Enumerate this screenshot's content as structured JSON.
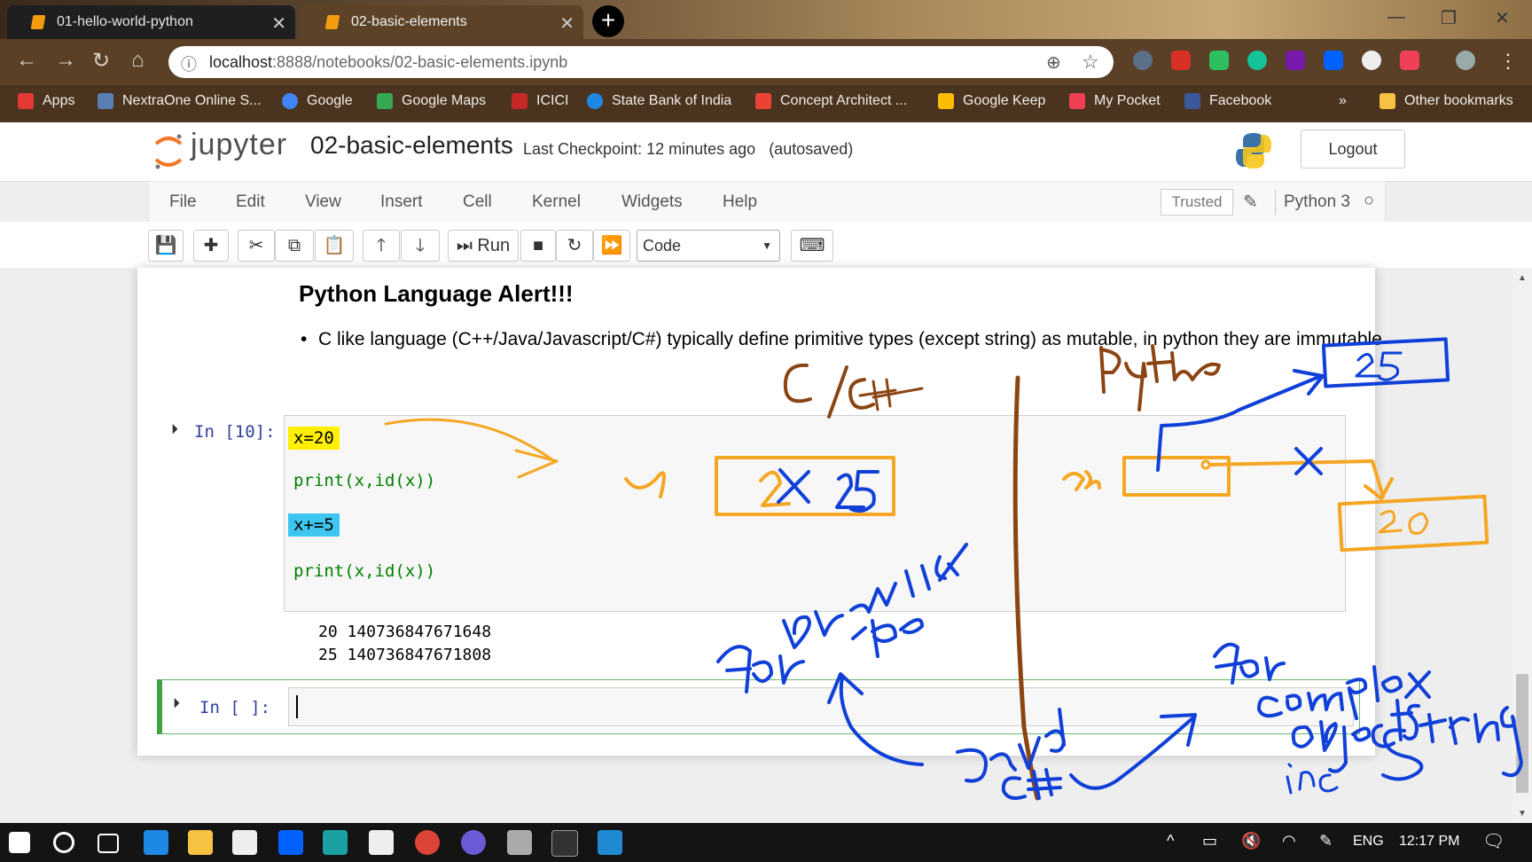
{
  "browser": {
    "tabs": [
      {
        "title": "01-hello-world-python"
      },
      {
        "title": "02-basic-elements"
      }
    ],
    "url_host": "localhost",
    "url_path": ":8888/notebooks/02-basic-elements.ipynb",
    "bookmarks": [
      {
        "label": "Apps",
        "color": "#e53935"
      },
      {
        "label": "NextraOne Online S...",
        "color": "#5b7fb5"
      },
      {
        "label": "Google",
        "color": "#4285f4"
      },
      {
        "label": "Google Maps",
        "color": "#34a853"
      },
      {
        "label": "ICICI",
        "color": "#c62828"
      },
      {
        "label": "State Bank of India",
        "color": "#1e88e5"
      },
      {
        "label": "Concept Architect ...",
        "color": "#ea4335"
      },
      {
        "label": "Google Keep",
        "color": "#fbbc04"
      },
      {
        "label": "My Pocket",
        "color": "#ef4056"
      },
      {
        "label": "Facebook",
        "color": "#3b5998"
      }
    ],
    "more": "»",
    "other_bookmarks": "Other bookmarks"
  },
  "jupyter": {
    "logo": "jupyter",
    "notebook_title": "02-basic-elements",
    "checkpoint": "Last Checkpoint: 12 minutes ago",
    "autosaved": "(autosaved)",
    "logout": "Logout",
    "menu": [
      "File",
      "Edit",
      "View",
      "Insert",
      "Cell",
      "Kernel",
      "Widgets",
      "Help"
    ],
    "trusted": "Trusted",
    "kernel": "Python 3",
    "run_label": "Run",
    "cell_type": "Code"
  },
  "notebook": {
    "md_title": "Python Language Alert!!!",
    "md_bullet": "C like language (C++/Java/Javascript/C#) typically define primitive types (except string) as mutable, in python they are immutable",
    "cell1": {
      "prompt": "In [10]:",
      "lines": [
        "x=20",
        "print(x,id(x))",
        "x+=5",
        "print(x,id(x))"
      ],
      "output": [
        "20 140736847671648",
        "25 140736847671808"
      ]
    },
    "cell2": {
      "prompt": "In [ ]:"
    }
  },
  "taskbar": {
    "lang": "ENG",
    "time": "12:17 PM"
  },
  "colors": {
    "accent_ink_blue": "#1040d8",
    "accent_ink_orange": "#f5a623",
    "accent_ink_brown": "#8b4513"
  }
}
